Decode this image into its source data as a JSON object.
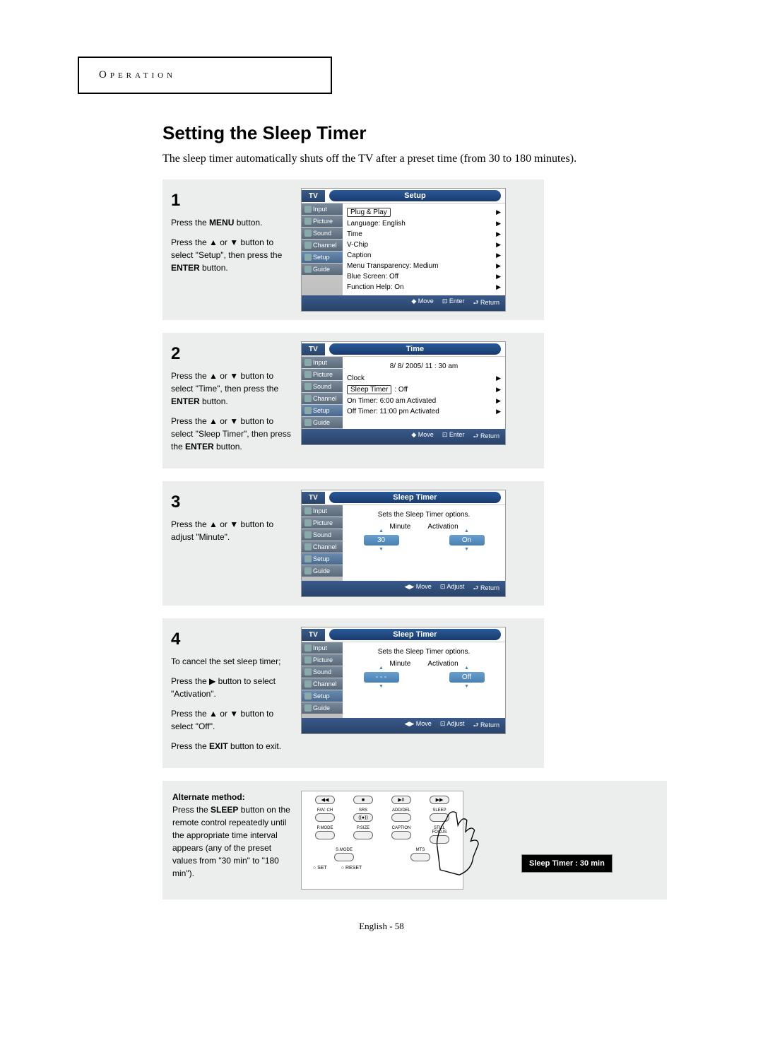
{
  "header": {
    "tab": "Operation"
  },
  "title": "Setting the Sleep Timer",
  "intro": "The sleep timer automatically shuts off the TV after a preset time (from 30 to 180 minutes).",
  "steps": [
    {
      "num": "1",
      "lines": [
        "Press the <b>MENU</b> button.",
        "Press the ▲ or ▼ button to select \"Setup\", then press the <b>ENTER</b> button."
      ],
      "osd": {
        "tv": "TV",
        "title": "Setup",
        "side": [
          "Input",
          "Picture",
          "Sound",
          "Channel",
          "Setup",
          "Guide"
        ],
        "active": 4,
        "main_rows": [
          {
            "l": "Plug & Play",
            "r": "",
            "sel": true
          },
          {
            "l": "Language",
            "r": ": English"
          },
          {
            "l": "Time",
            "r": ""
          },
          {
            "l": "V-Chip",
            "r": ""
          },
          {
            "l": "Caption",
            "r": ""
          },
          {
            "l": "Menu Transparency",
            "r": ": Medium"
          },
          {
            "l": "Blue Screen",
            "r": ": Off"
          },
          {
            "l": "Function Help",
            "r": ": On"
          }
        ],
        "footer": [
          "Move",
          "Enter",
          "Return"
        ],
        "footer_icon": "ud"
      }
    },
    {
      "num": "2",
      "lines": [
        "Press the ▲ or ▼ button to select \"Time\", then press the <b>ENTER</b> button.",
        "Press the ▲ or ▼ button to select \"Sleep Timer\", then press the <b>ENTER</b> button."
      ],
      "osd": {
        "tv": "TV",
        "title": "Time",
        "side": [
          "Input",
          "Picture",
          "Sound",
          "Channel",
          "Setup",
          "Guide"
        ],
        "active": 4,
        "top_text": "8/ 8/ 2005/ 11 : 30 am",
        "main_rows": [
          {
            "l": "Clock",
            "r": ""
          },
          {
            "l": "Sleep Timer",
            "r": ": Off",
            "sel": true
          },
          {
            "l": "On Timer",
            "r": ":   6:00 am Activated"
          },
          {
            "l": "Off Timer",
            "r": ": 11:00 pm Activated"
          }
        ],
        "footer": [
          "Move",
          "Enter",
          "Return"
        ],
        "footer_icon": "ud"
      }
    },
    {
      "num": "3",
      "lines": [
        "Press the ▲ or ▼ button to adjust \"Minute\"."
      ],
      "osd": {
        "tv": "TV",
        "title": "Sleep Timer",
        "side": [
          "Input",
          "Picture",
          "Sound",
          "Channel",
          "Setup",
          "Guide"
        ],
        "active": 4,
        "desc": "Sets the Sleep Timer options.",
        "pills_head": [
          "Minute",
          "Activation"
        ],
        "pills": [
          "30",
          "On"
        ],
        "footer": [
          "Move",
          "Adjust",
          "Return"
        ],
        "footer_icon": "lr"
      }
    },
    {
      "num": "4",
      "lines": [
        "To cancel the set sleep timer;",
        "Press the ▶ button to select \"Activation\".",
        "Press the ▲ or ▼ button to select \"Off\".",
        "Press the <b>EXIT</b> button to exit."
      ],
      "osd": {
        "tv": "TV",
        "title": "Sleep Timer",
        "side": [
          "Input",
          "Picture",
          "Sound",
          "Channel",
          "Setup",
          "Guide"
        ],
        "active": 4,
        "desc": "Sets the Sleep Timer options.",
        "pills_head": [
          "Minute",
          "Activation"
        ],
        "pills": [
          "- - -",
          "Off"
        ],
        "footer": [
          "Move",
          "Adjust",
          "Return"
        ],
        "footer_icon": "lr"
      }
    }
  ],
  "alt": {
    "heading": "Alternate method:",
    "body": "Press the <b>SLEEP</b> button on the remote control repeatedly until the appropriate time interval appears (any of the preset values from \"30 min\" to \"180 min\").",
    "remote_rows": [
      [
        "◀◀",
        "■",
        "▶II",
        "▶▶"
      ],
      [
        [
          "FAV. CH",
          ""
        ],
        [
          "SRS",
          "((●))"
        ],
        [
          "ADD/DEL",
          ""
        ],
        [
          "SLEEP",
          ""
        ]
      ],
      [
        [
          "P.MODE",
          ""
        ],
        [
          "P.SIZE",
          ""
        ],
        [
          "CAPTION",
          ""
        ],
        [
          "STILL FOCUS",
          ""
        ]
      ],
      [
        [
          "S.MODE",
          ""
        ],
        [
          "MTS",
          ""
        ]
      ],
      [
        "○ SET",
        "○ RESET"
      ]
    ],
    "tv_badge": "Sleep Timer : 30 min"
  },
  "footer_text": "English - 58"
}
